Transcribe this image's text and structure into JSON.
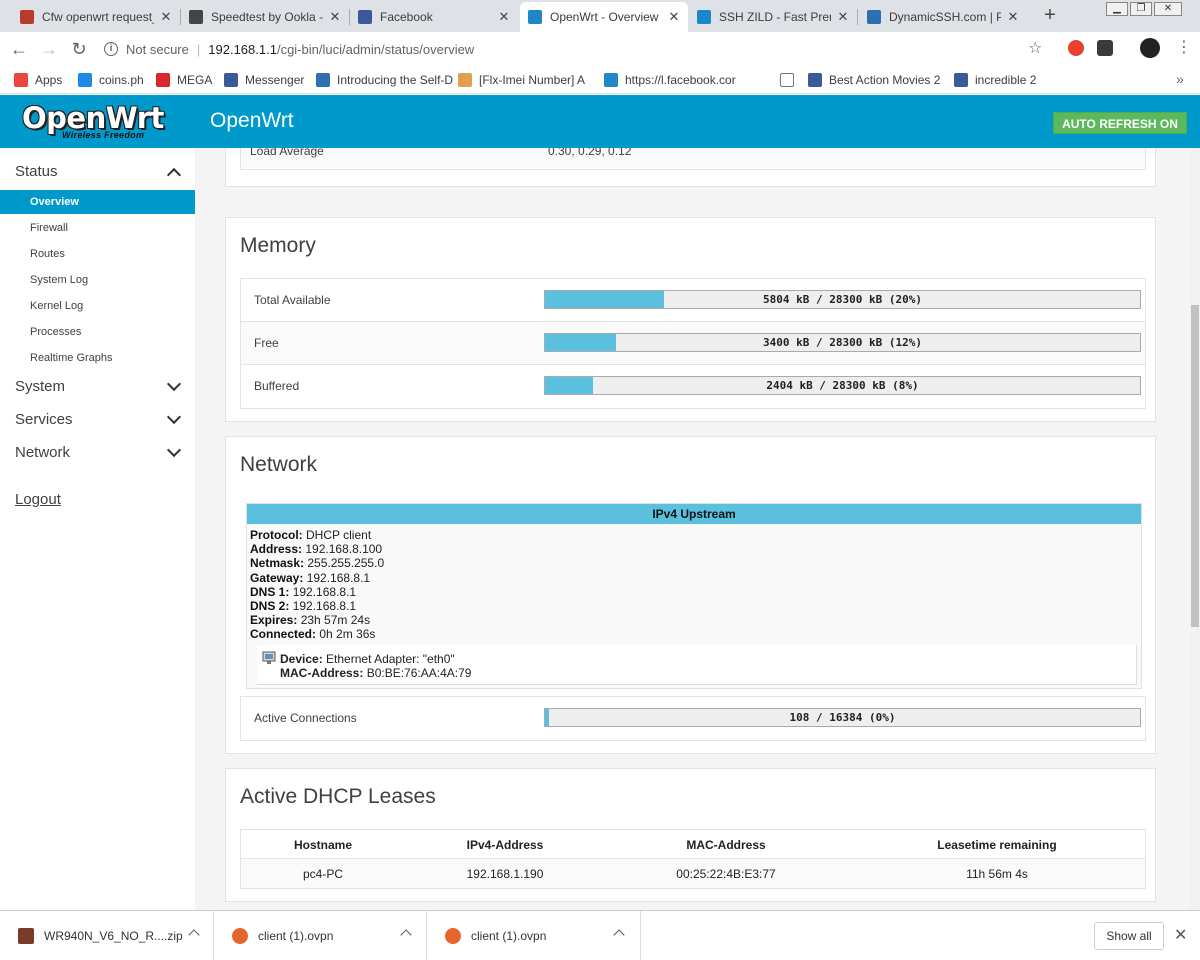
{
  "browser": {
    "tabs": [
      {
        "title": "Cfw openwrt request_",
        "icon_color": "#b73c2e",
        "active": false
      },
      {
        "title": "Speedtest by Ookla - T",
        "icon_color": "#444444",
        "active": false
      },
      {
        "title": "Facebook",
        "icon_color": "#3b5998",
        "active": false
      },
      {
        "title": "OpenWrt - Overview - L",
        "icon_color": "#1e88c7",
        "active": true
      },
      {
        "title": "SSH ZILD - Fast Premiu",
        "icon_color": "#1e88c7",
        "active": false
      },
      {
        "title": "DynamicSSH.com | Pre",
        "icon_color": "#2d6fb0",
        "active": false
      }
    ],
    "security_label": "Not secure",
    "url_host": "192.168.1.1",
    "url_path": "/cgi-bin/luci/admin/status/overview",
    "bookmarks": [
      {
        "label": "Apps",
        "icon_color": "#e8453c"
      },
      {
        "label": "coins.ph",
        "icon_color": "#1e88e5"
      },
      {
        "label": "MEGA",
        "icon_color": "#d9272e"
      },
      {
        "label": "Messenger",
        "icon_color": "#3b5998"
      },
      {
        "label": "Introducing the Self-D",
        "icon_color": "#2d6fb0"
      },
      {
        "label": "[Flx-Imei Number] A",
        "icon_color": "#e0a050"
      },
      {
        "label": "https://l.facebook.cor",
        "icon_color": "#1e88c7"
      },
      {
        "label": "",
        "icon_color": "#ffffff"
      },
      {
        "label": "Best Action Movies 2",
        "icon_color": "#3b5998"
      },
      {
        "label": "incredible 2",
        "icon_color": "#3b5998"
      }
    ]
  },
  "header": {
    "logo_main": "OpenWrt",
    "logo_sub": "Wireless Freedom",
    "title": "OpenWrt",
    "auto_refresh": "AUTO REFRESH ON"
  },
  "sidebar": {
    "sections": [
      {
        "label": "Status",
        "expanded": true
      },
      {
        "label": "System",
        "expanded": false
      },
      {
        "label": "Services",
        "expanded": false
      },
      {
        "label": "Network",
        "expanded": false
      }
    ],
    "status_items": [
      "Overview",
      "Firewall",
      "Routes",
      "System Log",
      "Kernel Log",
      "Processes",
      "Realtime Graphs"
    ],
    "logout": "Logout"
  },
  "system": {
    "load_label": "Load Average",
    "load_value": "0.30, 0.29, 0.12"
  },
  "memory": {
    "title": "Memory",
    "rows": [
      {
        "label": "Total Available",
        "text": "5804 kB / 28300 kB (20%)",
        "fraction": 0.2
      },
      {
        "label": "Free",
        "text": "3400 kB / 28300 kB (12%)",
        "fraction": 0.12
      },
      {
        "label": "Buffered",
        "text": "2404 kB / 28300 kB (8%)",
        "fraction": 0.08
      }
    ]
  },
  "network": {
    "title": "Network",
    "upstream_title": "IPv4 Upstream",
    "fields": [
      {
        "k": "Protocol:",
        "v": "DHCP client"
      },
      {
        "k": "Address:",
        "v": "192.168.8.100"
      },
      {
        "k": "Netmask:",
        "v": "255.255.255.0"
      },
      {
        "k": "Gateway:",
        "v": "192.168.8.1"
      },
      {
        "k": "DNS 1:",
        "v": "192.168.8.1"
      },
      {
        "k": "DNS 2:",
        "v": "192.168.8.1"
      },
      {
        "k": "Expires:",
        "v": "23h 57m 24s"
      },
      {
        "k": "Connected:",
        "v": "0h 2m 36s"
      }
    ],
    "device_key": "Device:",
    "device_value": "Ethernet Adapter: \"eth0\"",
    "mac_key": "MAC-Address:",
    "mac_value": "B0:BE:76:AA:4A:79",
    "conn_label": "Active Connections",
    "conn_text": "108 / 16384 (0%)",
    "conn_fraction": 0.0066
  },
  "dhcp": {
    "title": "Active DHCP Leases",
    "headers": [
      "Hostname",
      "IPv4-Address",
      "MAC-Address",
      "Leasetime remaining"
    ],
    "rows": [
      [
        "pc4-PC",
        "192.168.1.190",
        "00:25:22:4B:E3:77",
        "11h 56m 4s"
      ]
    ]
  },
  "downloads": {
    "items": [
      {
        "name": "WR940N_V6_NO_R....zip",
        "icon_color": "#7a3a2a"
      },
      {
        "name": "client (1).ovpn",
        "icon_color": "#e6652d"
      },
      {
        "name": "client (1).ovpn",
        "icon_color": "#e6652d"
      }
    ],
    "show_all": "Show all"
  }
}
